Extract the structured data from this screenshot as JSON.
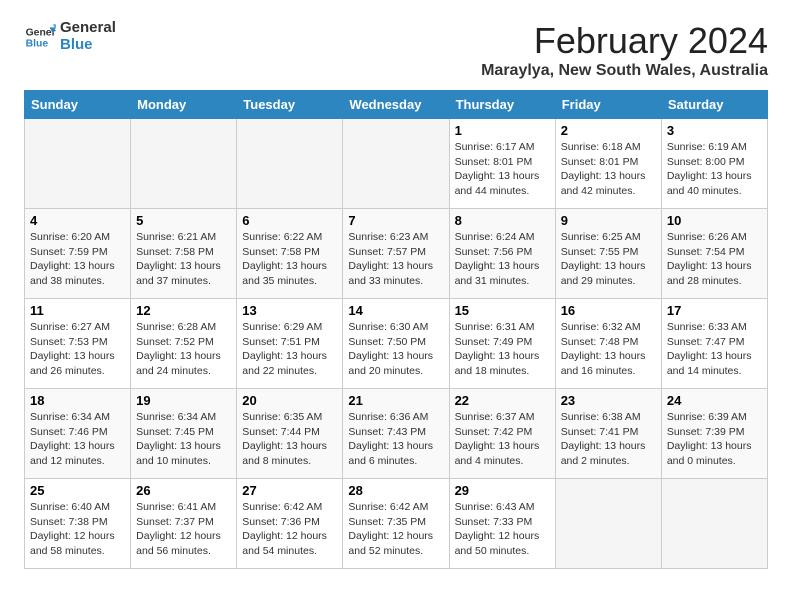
{
  "logo": {
    "line1": "General",
    "line2": "Blue"
  },
  "title": "February 2024",
  "subtitle": "Maraylya, New South Wales, Australia",
  "days_of_week": [
    "Sunday",
    "Monday",
    "Tuesday",
    "Wednesday",
    "Thursday",
    "Friday",
    "Saturday"
  ],
  "weeks": [
    [
      {
        "day": "",
        "info": ""
      },
      {
        "day": "",
        "info": ""
      },
      {
        "day": "",
        "info": ""
      },
      {
        "day": "",
        "info": ""
      },
      {
        "day": "1",
        "info": "Sunrise: 6:17 AM\nSunset: 8:01 PM\nDaylight: 13 hours\nand 44 minutes."
      },
      {
        "day": "2",
        "info": "Sunrise: 6:18 AM\nSunset: 8:01 PM\nDaylight: 13 hours\nand 42 minutes."
      },
      {
        "day": "3",
        "info": "Sunrise: 6:19 AM\nSunset: 8:00 PM\nDaylight: 13 hours\nand 40 minutes."
      }
    ],
    [
      {
        "day": "4",
        "info": "Sunrise: 6:20 AM\nSunset: 7:59 PM\nDaylight: 13 hours\nand 38 minutes."
      },
      {
        "day": "5",
        "info": "Sunrise: 6:21 AM\nSunset: 7:58 PM\nDaylight: 13 hours\nand 37 minutes."
      },
      {
        "day": "6",
        "info": "Sunrise: 6:22 AM\nSunset: 7:58 PM\nDaylight: 13 hours\nand 35 minutes."
      },
      {
        "day": "7",
        "info": "Sunrise: 6:23 AM\nSunset: 7:57 PM\nDaylight: 13 hours\nand 33 minutes."
      },
      {
        "day": "8",
        "info": "Sunrise: 6:24 AM\nSunset: 7:56 PM\nDaylight: 13 hours\nand 31 minutes."
      },
      {
        "day": "9",
        "info": "Sunrise: 6:25 AM\nSunset: 7:55 PM\nDaylight: 13 hours\nand 29 minutes."
      },
      {
        "day": "10",
        "info": "Sunrise: 6:26 AM\nSunset: 7:54 PM\nDaylight: 13 hours\nand 28 minutes."
      }
    ],
    [
      {
        "day": "11",
        "info": "Sunrise: 6:27 AM\nSunset: 7:53 PM\nDaylight: 13 hours\nand 26 minutes."
      },
      {
        "day": "12",
        "info": "Sunrise: 6:28 AM\nSunset: 7:52 PM\nDaylight: 13 hours\nand 24 minutes."
      },
      {
        "day": "13",
        "info": "Sunrise: 6:29 AM\nSunset: 7:51 PM\nDaylight: 13 hours\nand 22 minutes."
      },
      {
        "day": "14",
        "info": "Sunrise: 6:30 AM\nSunset: 7:50 PM\nDaylight: 13 hours\nand 20 minutes."
      },
      {
        "day": "15",
        "info": "Sunrise: 6:31 AM\nSunset: 7:49 PM\nDaylight: 13 hours\nand 18 minutes."
      },
      {
        "day": "16",
        "info": "Sunrise: 6:32 AM\nSunset: 7:48 PM\nDaylight: 13 hours\nand 16 minutes."
      },
      {
        "day": "17",
        "info": "Sunrise: 6:33 AM\nSunset: 7:47 PM\nDaylight: 13 hours\nand 14 minutes."
      }
    ],
    [
      {
        "day": "18",
        "info": "Sunrise: 6:34 AM\nSunset: 7:46 PM\nDaylight: 13 hours\nand 12 minutes."
      },
      {
        "day": "19",
        "info": "Sunrise: 6:34 AM\nSunset: 7:45 PM\nDaylight: 13 hours\nand 10 minutes."
      },
      {
        "day": "20",
        "info": "Sunrise: 6:35 AM\nSunset: 7:44 PM\nDaylight: 13 hours\nand 8 minutes."
      },
      {
        "day": "21",
        "info": "Sunrise: 6:36 AM\nSunset: 7:43 PM\nDaylight: 13 hours\nand 6 minutes."
      },
      {
        "day": "22",
        "info": "Sunrise: 6:37 AM\nSunset: 7:42 PM\nDaylight: 13 hours\nand 4 minutes."
      },
      {
        "day": "23",
        "info": "Sunrise: 6:38 AM\nSunset: 7:41 PM\nDaylight: 13 hours\nand 2 minutes."
      },
      {
        "day": "24",
        "info": "Sunrise: 6:39 AM\nSunset: 7:39 PM\nDaylight: 13 hours\nand 0 minutes."
      }
    ],
    [
      {
        "day": "25",
        "info": "Sunrise: 6:40 AM\nSunset: 7:38 PM\nDaylight: 12 hours\nand 58 minutes."
      },
      {
        "day": "26",
        "info": "Sunrise: 6:41 AM\nSunset: 7:37 PM\nDaylight: 12 hours\nand 56 minutes."
      },
      {
        "day": "27",
        "info": "Sunrise: 6:42 AM\nSunset: 7:36 PM\nDaylight: 12 hours\nand 54 minutes."
      },
      {
        "day": "28",
        "info": "Sunrise: 6:42 AM\nSunset: 7:35 PM\nDaylight: 12 hours\nand 52 minutes."
      },
      {
        "day": "29",
        "info": "Sunrise: 6:43 AM\nSunset: 7:33 PM\nDaylight: 12 hours\nand 50 minutes."
      },
      {
        "day": "",
        "info": ""
      },
      {
        "day": "",
        "info": ""
      }
    ]
  ]
}
